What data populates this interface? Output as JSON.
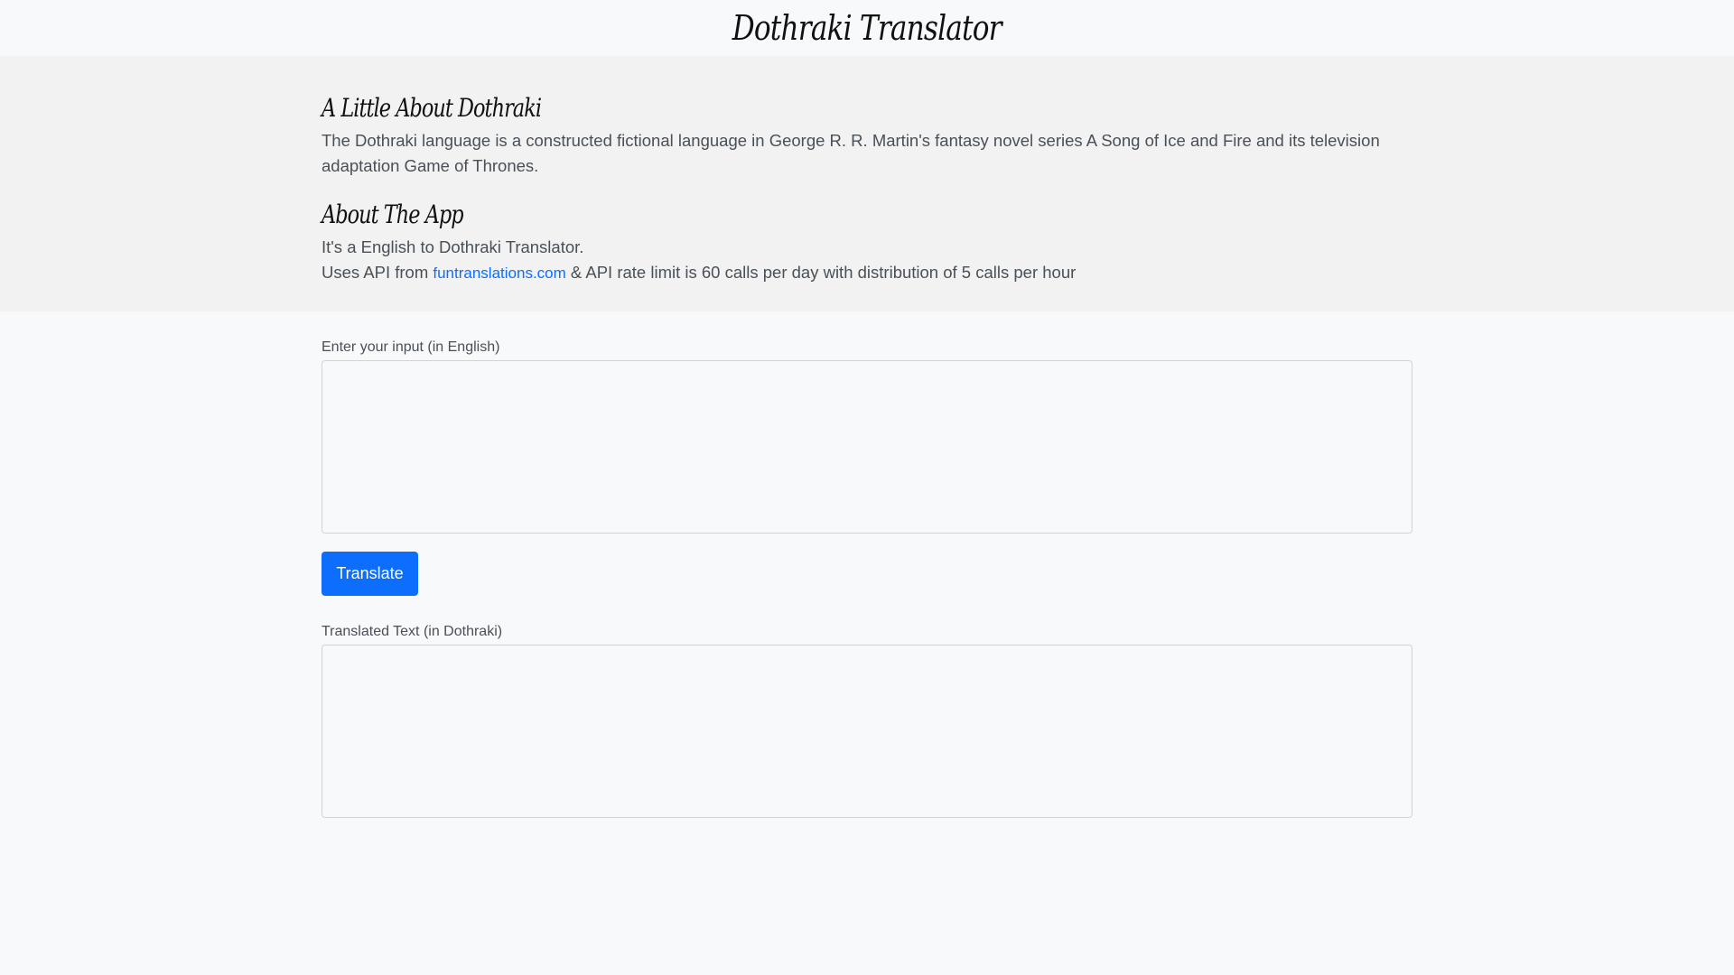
{
  "header": {
    "title": "Dothraki Translator"
  },
  "about_dothraki": {
    "heading": "A Little About Dothraki",
    "text": "The Dothraki language is a constructed fictional language in George R. R. Martin's fantasy novel series A Song of Ice and Fire and its television adaptation Game of Thrones."
  },
  "about_app": {
    "heading": "About The App",
    "line1": "It's a English to Dothraki Translator.",
    "line2_prefix": "Uses API from ",
    "link_text": "funtranslations.com",
    "line2_suffix": " & API rate limit is 60 calls per day with distribution of 5 calls per hour"
  },
  "input": {
    "label": "Enter your input (in English)",
    "value": "",
    "placeholder": ""
  },
  "translate_button": {
    "label": "Translate"
  },
  "output": {
    "label": "Translated Text (in Dothraki)",
    "value": ""
  },
  "colors": {
    "page_background": "#f8f9fa",
    "about_background": "#f2f2f2",
    "button_background": "#0d6efd",
    "link": "#0d6efd"
  }
}
